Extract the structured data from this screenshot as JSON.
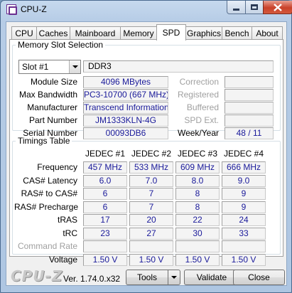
{
  "window": {
    "title": "CPU-Z"
  },
  "tabs": [
    "CPU",
    "Caches",
    "Mainboard",
    "Memory",
    "SPD",
    "Graphics",
    "Bench",
    "About"
  ],
  "active_tab": "SPD",
  "memory_slot": {
    "group_title": "Memory Slot Selection",
    "slot_selected": "Slot #1",
    "type": "DDR3",
    "labels": {
      "module_size": "Module Size",
      "max_bandwidth": "Max Bandwidth",
      "manufacturer": "Manufacturer",
      "part_number": "Part Number",
      "serial_number": "Serial Number",
      "correction": "Correction",
      "registered": "Registered",
      "buffered": "Buffered",
      "spd_ext": "SPD Ext.",
      "week_year": "Week/Year"
    },
    "values": {
      "module_size": "4096 MBytes",
      "max_bandwidth": "PC3-10700 (667 MHz)",
      "manufacturer": "Transcend Information",
      "part_number": "JM1333KLN-4G",
      "serial_number": "00093DB6",
      "correction": "",
      "registered": "",
      "buffered": "",
      "spd_ext": "",
      "week_year": "48 / 11"
    }
  },
  "timings": {
    "group_title": "Timings Table",
    "columns": [
      "JEDEC #1",
      "JEDEC #2",
      "JEDEC #3",
      "JEDEC #4"
    ],
    "rows": [
      {
        "label": "Frequency",
        "dim": false,
        "values": [
          "457 MHz",
          "533 MHz",
          "609 MHz",
          "666 MHz"
        ]
      },
      {
        "label": "CAS# Latency",
        "dim": false,
        "values": [
          "6.0",
          "7.0",
          "8.0",
          "9.0"
        ]
      },
      {
        "label": "RAS# to CAS#",
        "dim": false,
        "values": [
          "6",
          "7",
          "8",
          "9"
        ]
      },
      {
        "label": "RAS# Precharge",
        "dim": false,
        "values": [
          "6",
          "7",
          "8",
          "9"
        ]
      },
      {
        "label": "tRAS",
        "dim": false,
        "values": [
          "17",
          "20",
          "22",
          "24"
        ]
      },
      {
        "label": "tRC",
        "dim": false,
        "values": [
          "23",
          "27",
          "30",
          "33"
        ]
      },
      {
        "label": "Command Rate",
        "dim": true,
        "values": [
          "",
          "",
          "",
          ""
        ]
      },
      {
        "label": "Voltage",
        "dim": false,
        "values": [
          "1.50 V",
          "1.50 V",
          "1.50 V",
          "1.50 V"
        ]
      }
    ]
  },
  "footer": {
    "logo": "CPU-Z",
    "version": "Ver. 1.74.0.x32",
    "tools_label": "Tools",
    "validate_label": "Validate",
    "close_label": "Close"
  }
}
